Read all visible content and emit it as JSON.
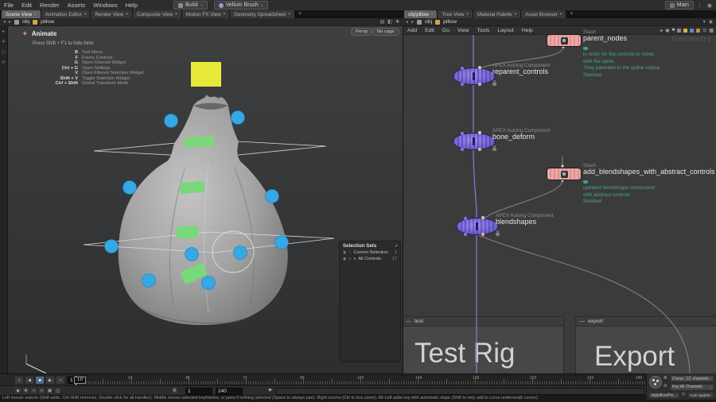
{
  "colors": {
    "stash_pink": "#eda8a8",
    "apex_purple": "#7465d6",
    "comment_teal": "#46a592",
    "control_blue": "#35a8e6",
    "band_green": "#79d879",
    "pivot_yellow": "#e8ea3a",
    "wire_purple": "#8b7ce8"
  },
  "icons": {
    "chevron_down": "▾",
    "updown": "↕",
    "minus": "—",
    "plus": "+",
    "back_arrow": "◂",
    "fwd_arrow": "▸",
    "jump_start": "«",
    "play_reverse": "◀",
    "stop": "■",
    "play": "▶",
    "jump_end": "»",
    "kebab": "⋮",
    "user_circle": "◉",
    "refresh": "↻",
    "external": "↗",
    "radio_on": "●",
    "radio_off": "○",
    "dot_target": "◉",
    "animate_state": "✦"
  },
  "menubar": {
    "items": [
      "File",
      "Edit",
      "Render",
      "Assets",
      "Windows",
      "Help"
    ],
    "shelf_set": "Build",
    "current_tool": "Vellum Brush",
    "desktop": "Main"
  },
  "left_pane": {
    "tabs": [
      "Scene View",
      "Animation Editor",
      "Render View",
      "Composite View",
      "Motion FX View",
      "Geometry Spreadsheet"
    ],
    "path": {
      "root": "obj",
      "node": "pillow"
    },
    "viewport": {
      "state": "Animate",
      "hide_hint": "Press Shift + F1 to hide hints",
      "hints": [
        {
          "key": "B",
          "desc": "Tool Menu"
        },
        {
          "key": "F",
          "desc": "Frame Controls"
        },
        {
          "key": "G",
          "desc": "Open Channel Widget"
        },
        {
          "key": "Ctrl + G",
          "desc": "Open Settings"
        },
        {
          "key": "V",
          "desc": "Open Filtered Selection Widget"
        },
        {
          "key": "Shift + V",
          "desc": "Toggle Selection Widget"
        },
        {
          "key": "Ctrl + Shift",
          "desc": "Global Transform Mode"
        }
      ],
      "camera": "Persp",
      "cage": "No cage",
      "selection_sets": {
        "title": "Selection Sets",
        "rows": [
          {
            "label": "Current Selection",
            "count": "1"
          },
          {
            "label": "All Controls",
            "count": "17"
          }
        ]
      }
    }
  },
  "right_pane": {
    "tabs": [
      "obj/pillow",
      "Tree View",
      "Material Palette",
      "Asset Browser"
    ],
    "menu": [
      "Add",
      "Edit",
      "Go",
      "View",
      "Tools",
      "Layout",
      "Help"
    ],
    "path": {
      "root": "obj",
      "node": "pillow"
    },
    "context_label": "Geometry",
    "nodes": {
      "parent_nodes": {
        "type": "Stash",
        "name": "parent_nodes",
        "comment": [
          "in order for the controls to  move",
          "with the spine,",
          "They parented to the spline output.",
          "Stashed"
        ]
      },
      "reparent_controls": {
        "type": "APEX Autorig Component",
        "name": "reparent_controls"
      },
      "bone_deform": {
        "type": "APEX Autorig Component",
        "name": "bone_deform"
      },
      "add_blendshapes": {
        "type": "Stash",
        "name": "add_blendshapes_with_abstract_controls",
        "comment": [
          "updated blendshape component",
          "with abstract controls",
          "Stashed"
        ]
      },
      "blendshapes": {
        "type": "APEX Autorig Component",
        "name": "blendshapes"
      }
    },
    "boxes": {
      "test": {
        "label": "test",
        "title": "Test Rig"
      },
      "export": {
        "label": "export",
        "title": "Export"
      }
    },
    "footer": {
      "path_combo": "obj/pillow/Ho...",
      "update_mode": "Auto Update"
    }
  },
  "playbar": {
    "frame": "1.0",
    "playhead_label": "1.0",
    "tick_labels": [
      "24",
      "48",
      "72",
      "96",
      "120",
      "144",
      "168",
      "192",
      "216",
      "240"
    ],
    "range_start": "1",
    "range_end": "240",
    "keys_summary": "0 keys, 1/1 channels",
    "key_action": "Key All Channels"
  },
  "statusbar": {
    "help": "Left mouse selects (Shift adds, Ctrl-Shift removes, Double-click for all handles). Middle moves selected keyframes, or pans if nothing selected (Space to always pan). Right zooms (Ctrl to box zoom). Alt-Left adds key with automatic slope (Shift to only add to curve underneath cursor)."
  }
}
